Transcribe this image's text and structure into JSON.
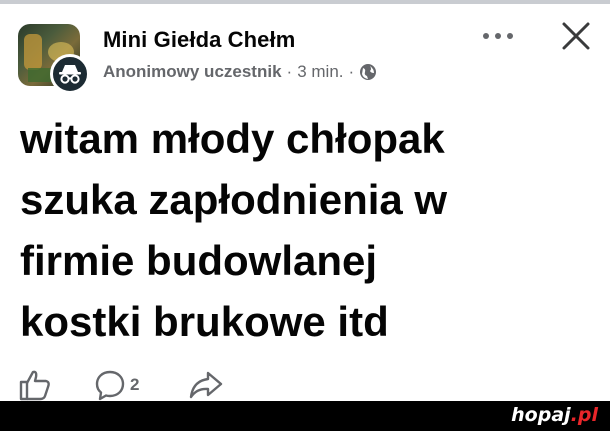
{
  "post": {
    "group_name": "Mini Giełda Chełm",
    "author": "Anonimowy uczestnik",
    "separator": "·",
    "time": "3 min.",
    "audience_icon": "globe-icon",
    "text_lines": [
      "witam młody chłopak",
      "szuka zapłodnienia w",
      "firmie budowlanej",
      "kostki brukowe itd"
    ]
  },
  "header_actions": {
    "more_icon": "more-dots-icon",
    "close_icon": "close-icon"
  },
  "actions": {
    "like_icon": "thumbs-up-icon",
    "comment_icon": "comment-icon",
    "comment_count": "2",
    "share_icon": "share-icon"
  },
  "watermark": {
    "name": "hopaj",
    "tld": ".pl"
  },
  "colors": {
    "text_primary": "#050505",
    "text_secondary": "#65676b",
    "footer_bg": "#000000",
    "watermark_accent": "#e8262a"
  }
}
